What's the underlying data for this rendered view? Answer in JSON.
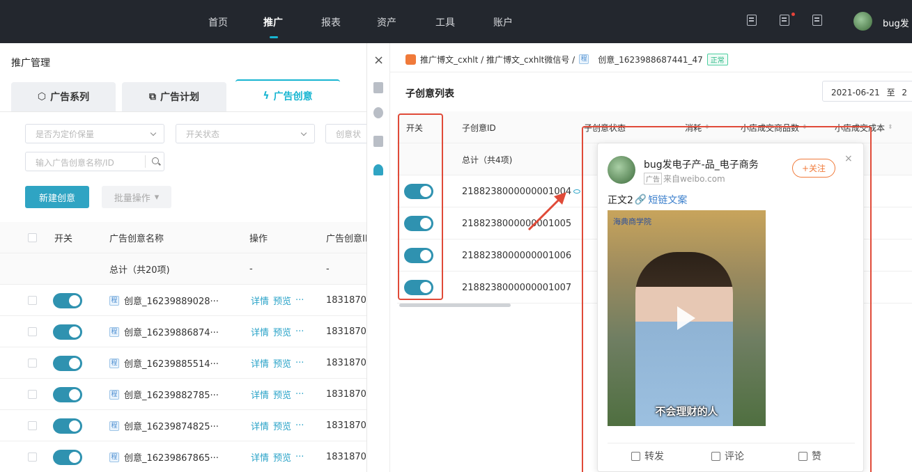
{
  "topnav": {
    "items": [
      {
        "label": "首页",
        "active": false
      },
      {
        "label": "推广",
        "active": true
      },
      {
        "label": "报表",
        "active": false
      },
      {
        "label": "资产",
        "active": false
      },
      {
        "label": "工具",
        "active": false
      },
      {
        "label": "账户",
        "active": false
      }
    ],
    "username": "bug发",
    "accent_color": "#17b5d1"
  },
  "left": {
    "page_title": "推广管理",
    "tabs": [
      {
        "label": "广告系列",
        "icon": "cube-icon",
        "active": false
      },
      {
        "label": "广告计划",
        "icon": "copy-icon",
        "active": false
      },
      {
        "label": "广告创意",
        "icon": "lightning-icon",
        "active": true
      }
    ],
    "filters": {
      "pricing": "是否为定价保量",
      "switch_status": "开关状态",
      "creative_status": "创意状",
      "search_placeholder": "输入广告创意名称/ID"
    },
    "new_button": "新建创意",
    "batch_button": "批量操作",
    "table": {
      "columns": [
        "开关",
        "广告创意名称",
        "操作",
        "广告创意II"
      ],
      "total_label": "总计（共20项)",
      "total_ops": "-",
      "total_id": "-",
      "action_detail": "详情",
      "action_preview": "预览",
      "action_more": "···",
      "prog_badge": "程",
      "rows": [
        {
          "name": "创意_16239889028···",
          "id": "1831870"
        },
        {
          "name": "创意_16239886874···",
          "id": "1831870"
        },
        {
          "name": "创意_16239885514···",
          "id": "1831870"
        },
        {
          "name": "创意_16239882785···",
          "id": "1831870"
        },
        {
          "name": "创意_16239874825···",
          "id": "1831870"
        },
        {
          "name": "创意_16239867865···",
          "id": "1831870"
        }
      ]
    }
  },
  "drawer": {
    "close_icon": "×",
    "breadcrumb": "推广博文_cxhlt / 推广博文_cxhlt微信号 /",
    "prog_badge": "程",
    "creative_name": "创意_1623988687441_47",
    "status": "正常",
    "sub_title": "子创意列表",
    "date_start": "2021-06-21",
    "date_sep": "至",
    "date_end": "2",
    "columns": [
      "开关",
      "子创意ID",
      "子创意状态",
      "消耗",
      "小店成交商品数",
      "小店成交成本"
    ],
    "total_label": "总计（共4项)",
    "rows": [
      {
        "id": "2188238000000001004",
        "on": true
      },
      {
        "id": "2188238000000001005",
        "on": true
      },
      {
        "id": "2188238000000001006",
        "on": true
      },
      {
        "id": "2188238000000001007",
        "on": true
      }
    ]
  },
  "preview": {
    "account_name": "bug发电子产-品_电子商务",
    "ad_tag": "广告",
    "source": "来自weibo.com",
    "follow_label": "+关注",
    "close_label": "×",
    "body_text": "正文2",
    "short_link": "短链文案",
    "video_brand": "海典商学院",
    "video_caption": "不会理财的人",
    "actions": [
      {
        "label": "转发",
        "icon": "share-icon"
      },
      {
        "label": "评论",
        "icon": "comment-icon"
      },
      {
        "label": "赞",
        "icon": "thumbs-up-icon"
      }
    ]
  },
  "annotation_color": "#e04a38"
}
